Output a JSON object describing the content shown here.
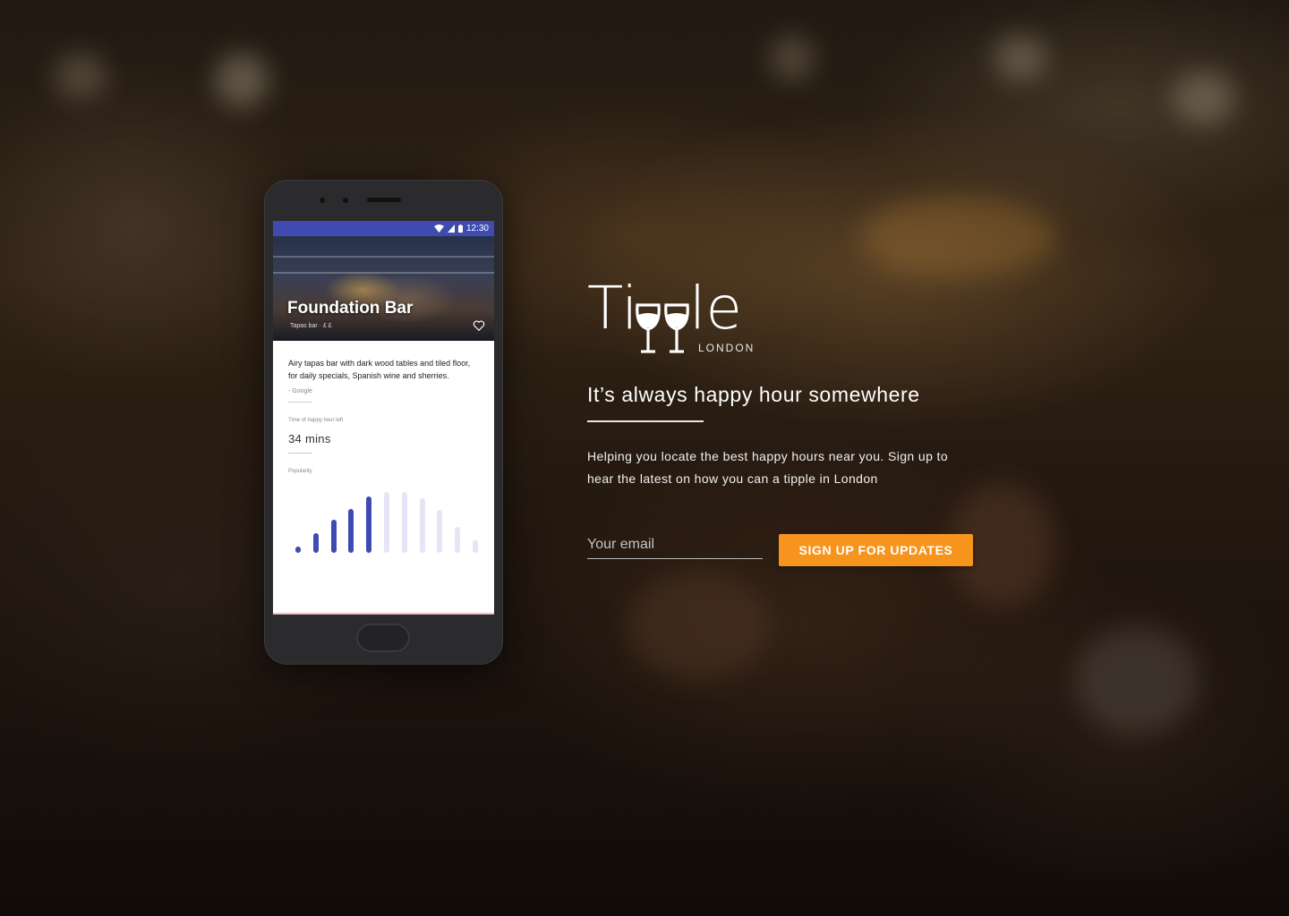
{
  "phone": {
    "status_time": "12:30",
    "venue_name": "Foundation Bar",
    "venue_meta": "Tapas bar · £ £",
    "description": "Airy tapas bar with dark wood tables and tiled floor, for daily specials, Spanish wine and sherries.",
    "source": "- Google",
    "time_label": "Time of happy hour left",
    "time_value": "34 mins",
    "popularity_label": "Popularity",
    "popularity": [
      0.1,
      0.33,
      0.55,
      0.72,
      0.92,
      1.0,
      1.0,
      0.9,
      0.7,
      0.42,
      0.2
    ],
    "popularity_active_count": 5,
    "bar_color_active": "#3f4bb1",
    "bar_color_inactive": "#e4e6f6"
  },
  "brand": {
    "logo_text_start": "Ti",
    "logo_text_end": "le",
    "logo_city": "LONDON",
    "logo_icon": "wine-glasses-icon"
  },
  "hero": {
    "tagline": "It’s always happy hour somewhere",
    "intro": "Helping you locate the best happy hours near you. Sign up to hear the latest on how you can a tipple in London"
  },
  "form": {
    "email_placeholder": "Your email",
    "email_value": "",
    "signup_label": "SIGN UP FOR UPDATES",
    "accent": "#f7941d"
  }
}
